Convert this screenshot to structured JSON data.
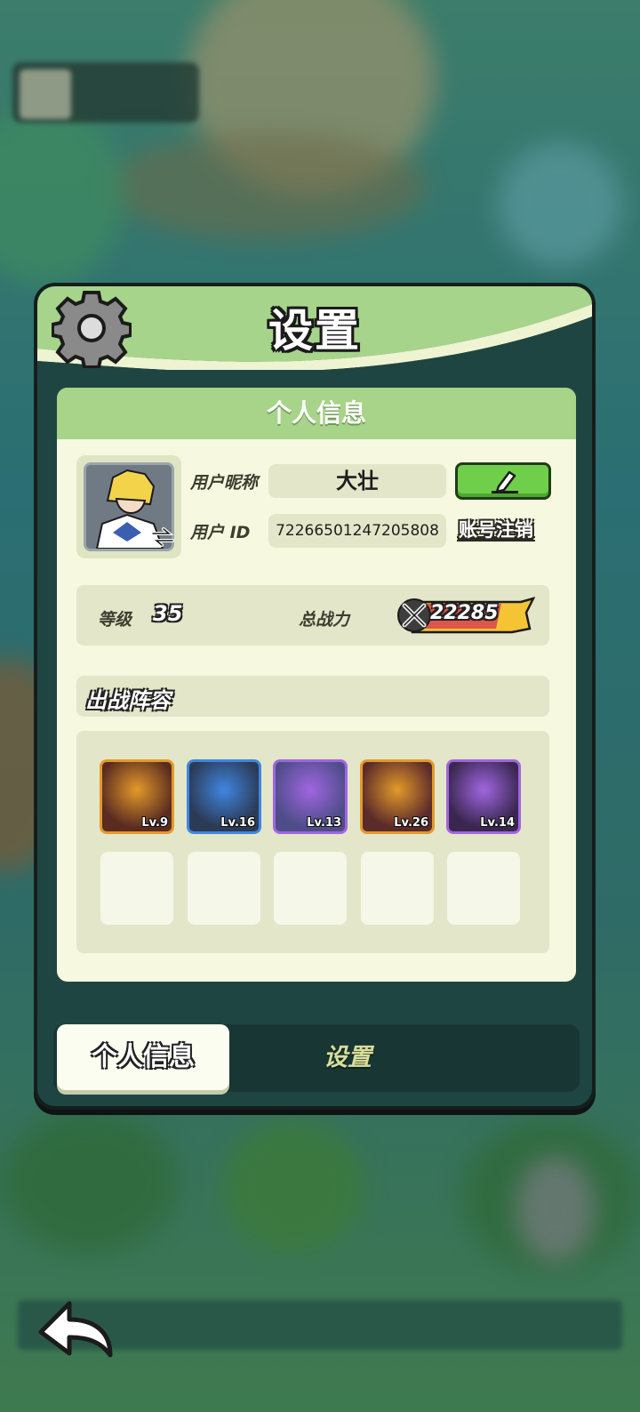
{
  "panel": {
    "title": "设置"
  },
  "card": {
    "header": "个人信息",
    "nickname_label": "用户昵称",
    "nickname_value": "大壮",
    "id_label": "用户 ID",
    "id_value": "72266501247205808",
    "cancel_account": "账号注销",
    "level_label": "等级",
    "level_value": "35",
    "power_label": "总战力",
    "power_value": "22285",
    "lineup_title": "出战阵容",
    "heroes": [
      {
        "level": "Lv.9",
        "frame_color": "#e39a2a",
        "bg": "#5a2b20"
      },
      {
        "level": "Lv.16",
        "frame_color": "#3f86e0",
        "bg": "#2b3a55"
      },
      {
        "level": "Lv.13",
        "frame_color": "#a066e0",
        "bg": "#4e4d8a"
      },
      {
        "level": "Lv.26",
        "frame_color": "#e39a2a",
        "bg": "#5b2a2a"
      },
      {
        "level": "Lv.14",
        "frame_color": "#a066e0",
        "bg": "#3a2750"
      }
    ]
  },
  "tabs": {
    "active": "个人信息",
    "inactive": "设置"
  },
  "icons": {
    "settings": "gear-icon",
    "edit": "pencil-icon",
    "back": "back-arrow-icon",
    "power": "swords-icon"
  }
}
